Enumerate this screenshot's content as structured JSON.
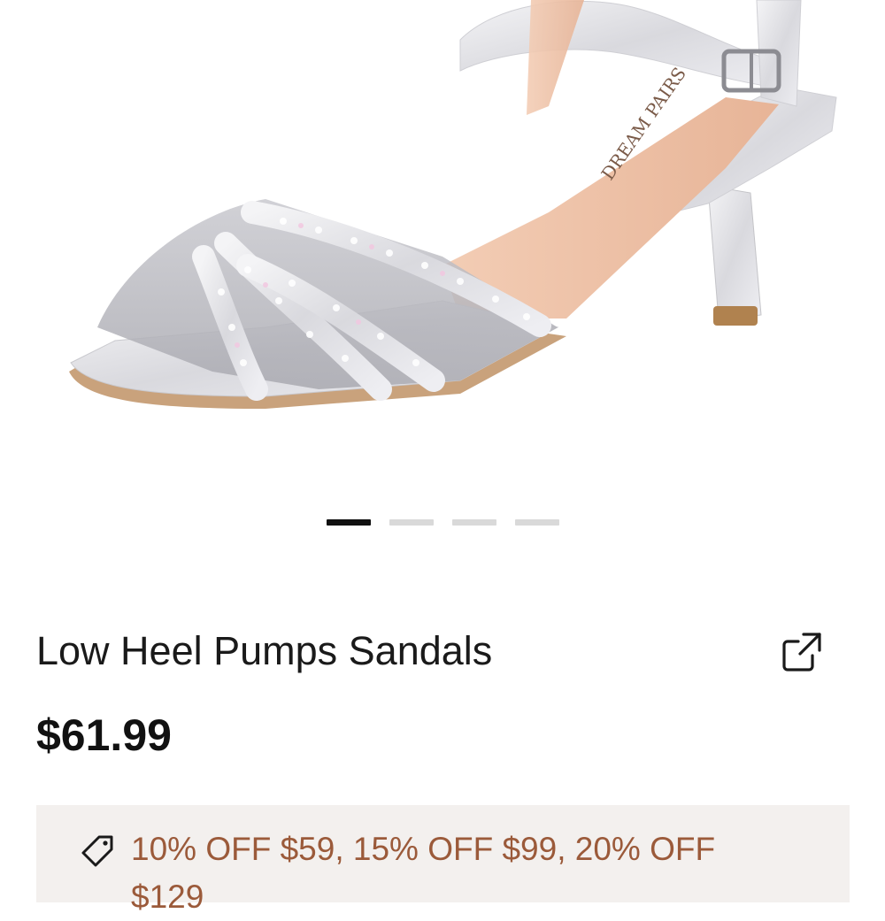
{
  "product": {
    "title": "Low Heel Pumps Sandals",
    "price": "$61.99",
    "image": {
      "description_icon": "sandal-image",
      "brand_on_insole": "DREAM PAIRS"
    },
    "gallery": {
      "count": 4,
      "active_index": 0
    }
  },
  "promo": {
    "icon": "tag-icon",
    "text": "10% OFF $59,  15% OFF $99, 20% OFF $129"
  },
  "actions": {
    "share_icon": "share-external-icon"
  },
  "colors": {
    "promo_bg": "#f3f0ee",
    "promo_text": "#9b5a3a",
    "dot_active": "#111111",
    "dot_inactive": "#d9d9d9"
  }
}
